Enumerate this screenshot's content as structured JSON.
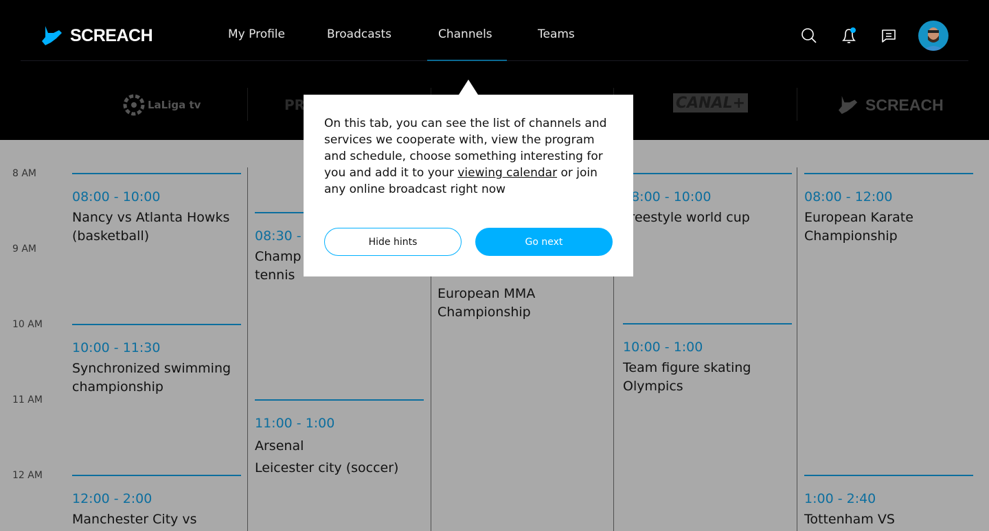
{
  "brand": {
    "name": "SCREACH",
    "accent": "#00b0ff"
  },
  "nav": {
    "items": [
      {
        "label": "My Profile"
      },
      {
        "label": "Broadcasts"
      },
      {
        "label": "Channels",
        "active": true
      },
      {
        "label": "Teams"
      }
    ]
  },
  "header_icons": [
    "search-icon",
    "bell-icon",
    "chat-icon",
    "avatar"
  ],
  "channels": [
    {
      "name": "LaLiga tv"
    },
    {
      "name": "PR"
    },
    {
      "name": "CANAL+"
    },
    {
      "name": "SCREACH"
    }
  ],
  "hours": [
    "8 AM",
    "9 AM",
    "10 AM",
    "11 AM",
    "12 AM"
  ],
  "columns": [
    {
      "events": [
        {
          "time": "08:00 - 10:00",
          "title": "Nancy vs Atlanta Howks (basketball)"
        },
        {
          "time": "10:00 - 11:30",
          "title": "Synchronized swimming championship"
        },
        {
          "time": "12:00 - 2:00",
          "title": "Manchester City vs"
        }
      ]
    },
    {
      "events": [
        {
          "time": "08:30 - ",
          "title": "Champ tennis"
        },
        {
          "time": "11:00 - 1:00",
          "title": "Arsenal\nLeicester city (soccer)"
        }
      ]
    },
    {
      "events": [
        {
          "time": "",
          "title": "European MMA Championship"
        }
      ]
    },
    {
      "events": [
        {
          "time": "08:00 - 10:00",
          "title": "Freestyle world cup"
        },
        {
          "time": "10:00 - 1:00",
          "title": "Team figure skating Olympics"
        }
      ]
    },
    {
      "events": [
        {
          "time": "08:00 - 12:00",
          "title": "European Karate Championship"
        },
        {
          "time": "1:00 - 2:40",
          "title": "Tottenham VS"
        }
      ]
    }
  ],
  "hint": {
    "text_before": "On this tab, you can see the list of channels and services we cooperate with, view the program and schedule, choose something interesting for you and add it to your ",
    "link": "viewing calendar",
    "text_after": " or join any online broadcast right now",
    "hide_label": "Hide hints",
    "next_label": "Go next"
  }
}
